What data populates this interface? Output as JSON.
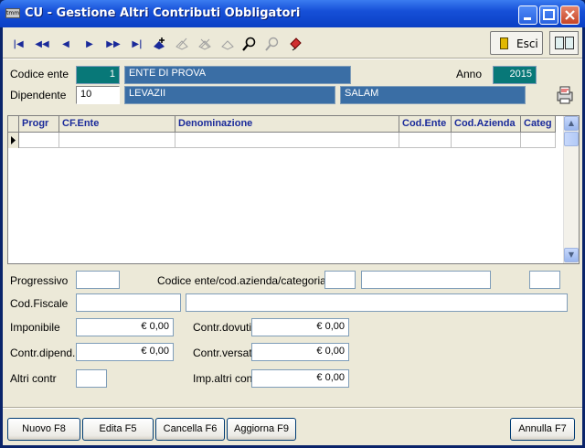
{
  "window": {
    "title": "CU - Gestione Altri Contributi Obbligatori",
    "app_icon_text": "tmm"
  },
  "toolbar": {
    "esci_label": "Esci",
    "nav_buttons": [
      {
        "icon": "first-record-icon",
        "glyph": "|◀"
      },
      {
        "icon": "prev-page-icon",
        "glyph": "◀◀"
      },
      {
        "icon": "prev-record-icon",
        "glyph": "◀"
      },
      {
        "icon": "next-record-icon",
        "glyph": "▶"
      },
      {
        "icon": "next-page-icon",
        "glyph": "▶▶"
      },
      {
        "icon": "last-record-icon",
        "glyph": "▶|"
      }
    ]
  },
  "header": {
    "codice_ente_label": "Codice ente",
    "codice_ente_value": "1",
    "ente_name": "ENTE DI PROVA",
    "anno_label": "Anno",
    "anno_value": "2015",
    "dipendente_label": "Dipendente",
    "dipendente_code": "10",
    "cognome": "LEVAZII",
    "nome": "SALAM"
  },
  "grid": {
    "columns": [
      "Progr",
      "CF.Ente",
      "Denominazione",
      "Cod.Ente",
      "Cod.Azienda",
      "Categ"
    ],
    "rows": [
      [
        "",
        "",
        "",
        "",
        "",
        ""
      ]
    ]
  },
  "detail": {
    "progressivo_label": "Progressivo",
    "progressivo_value": "",
    "codici_label": "Codice ente/cod.azienda/categoria",
    "cod_fiscale_label": "Cod.Fiscale",
    "imponibile_label": "Imponibile",
    "imponibile_value": "€ 0,00",
    "contr_dovuti_label": "Contr.dovuti",
    "contr_dovuti_value": "€ 0,00",
    "contr_dipend_label": "Contr.dipend.",
    "contr_dipend_value": "€ 0,00",
    "contr_versati_label": "Contr.versati",
    "contr_versati_value": "€ 0,00",
    "altri_contr_label": "Altri contr",
    "imp_altri_contr_label": "Imp.altri contr",
    "imp_altri_contr_value": "€ 0,00"
  },
  "buttons": {
    "nuovo": "Nuovo F8",
    "edita": "Edita F5",
    "cancella": "Cancella F6",
    "aggiorna": "Aggiorna F9",
    "annulla": "Annulla F7"
  }
}
